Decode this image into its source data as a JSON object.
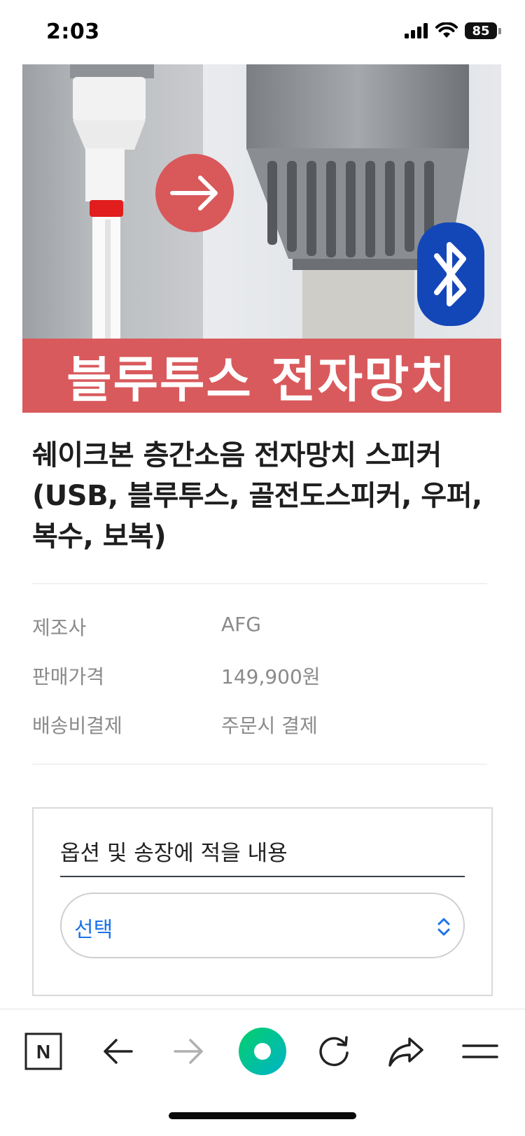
{
  "status_bar": {
    "time": "2:03",
    "battery": "85"
  },
  "product": {
    "banner_text": "블루투스 전자망치",
    "title": "쉐이크본 층간소음 전자망치 스피커(USB, 블루투스, 골전도스피커, 우퍼, 복수, 보복)",
    "info": [
      {
        "label": "제조사",
        "value": "AFG"
      },
      {
        "label": "판매가격",
        "value": "149,900원"
      },
      {
        "label": "배송비결제",
        "value": "주문시 결제"
      }
    ]
  },
  "options": {
    "title": "옵션 및 송장에 적을 내용",
    "select_value": "선택"
  },
  "toolbar": {
    "n_label": "N"
  },
  "colors": {
    "banner": "#d95a5c",
    "accent_blue": "#1c74e9",
    "naver_green": "#03c75a",
    "bluetooth_blue": "#1347b8"
  },
  "icons": [
    "signal-icon",
    "wifi-icon",
    "battery-icon",
    "naver-n-icon",
    "back-arrow-icon",
    "forward-arrow-icon",
    "naver-green-dot-icon",
    "reload-icon",
    "share-icon",
    "menu-icon",
    "bluetooth-icon",
    "right-arrow-circle-icon"
  ]
}
